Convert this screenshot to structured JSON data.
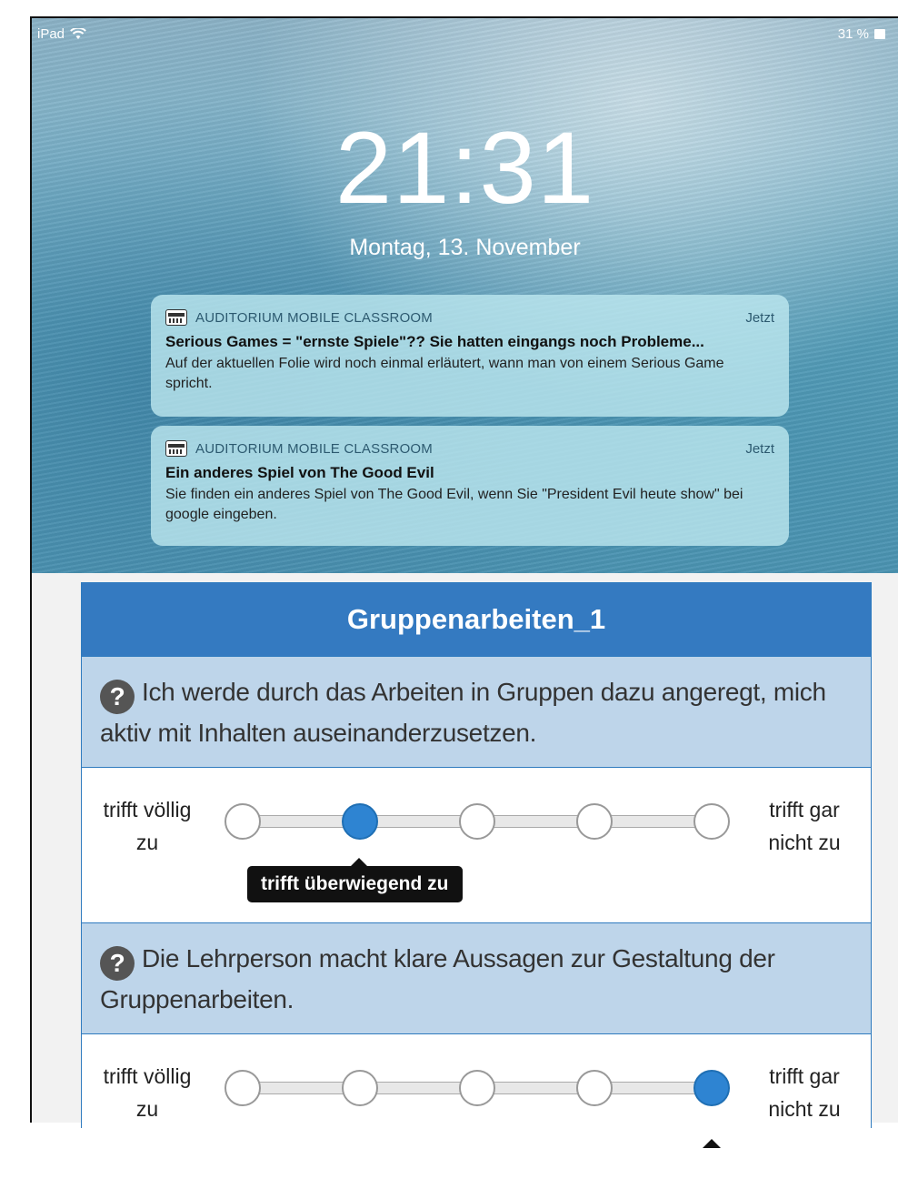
{
  "status_bar": {
    "device": "iPad",
    "battery": "31 %"
  },
  "lock_screen": {
    "time": "21:31",
    "date": "Montag, 13. November",
    "notifications": [
      {
        "app": "AUDITORIUM MOBILE CLASSROOM",
        "time": "Jetzt",
        "title": "Serious Games = \"ernste Spiele\"?? Sie hatten eingangs noch Probleme...",
        "body": "Auf der aktuellen Folie wird noch einmal erläutert, wann man von einem Serious Game spricht."
      },
      {
        "app": "AUDITORIUM MOBILE CLASSROOM",
        "time": "Jetzt",
        "title": "Ein anderes Spiel von The Good Evil",
        "body": "Sie finden ein anderes Spiel von The Good Evil, wenn Sie \"President Evil heute show\" bei google eingeben."
      }
    ]
  },
  "survey": {
    "title": "Gruppenarbeiten_1",
    "questions": [
      {
        "text": "Ich werde durch das Arbeiten in Gruppen dazu angeregt, mich aktiv mit Inhalten auseinanderzusetzen.",
        "left_label_1": "trifft völlig",
        "left_label_2": "zu",
        "right_label_1": "trifft gar",
        "right_label_2": "nicht zu",
        "selected_index": 1,
        "tooltip": "trifft überwiegend zu"
      },
      {
        "text": "Die Lehrperson macht klare Aussagen zur Gestaltung der Gruppenarbeiten.",
        "left_label_1": "trifft völlig",
        "left_label_2": "zu",
        "right_label_1": "trifft gar",
        "right_label_2": "nicht zu",
        "selected_index": 4
      }
    ],
    "icons": {
      "question": "question-circle-icon"
    },
    "colors": {
      "header": "#347ac1",
      "question_bg": "#bed5ea",
      "selected": "#2e84d2"
    }
  }
}
